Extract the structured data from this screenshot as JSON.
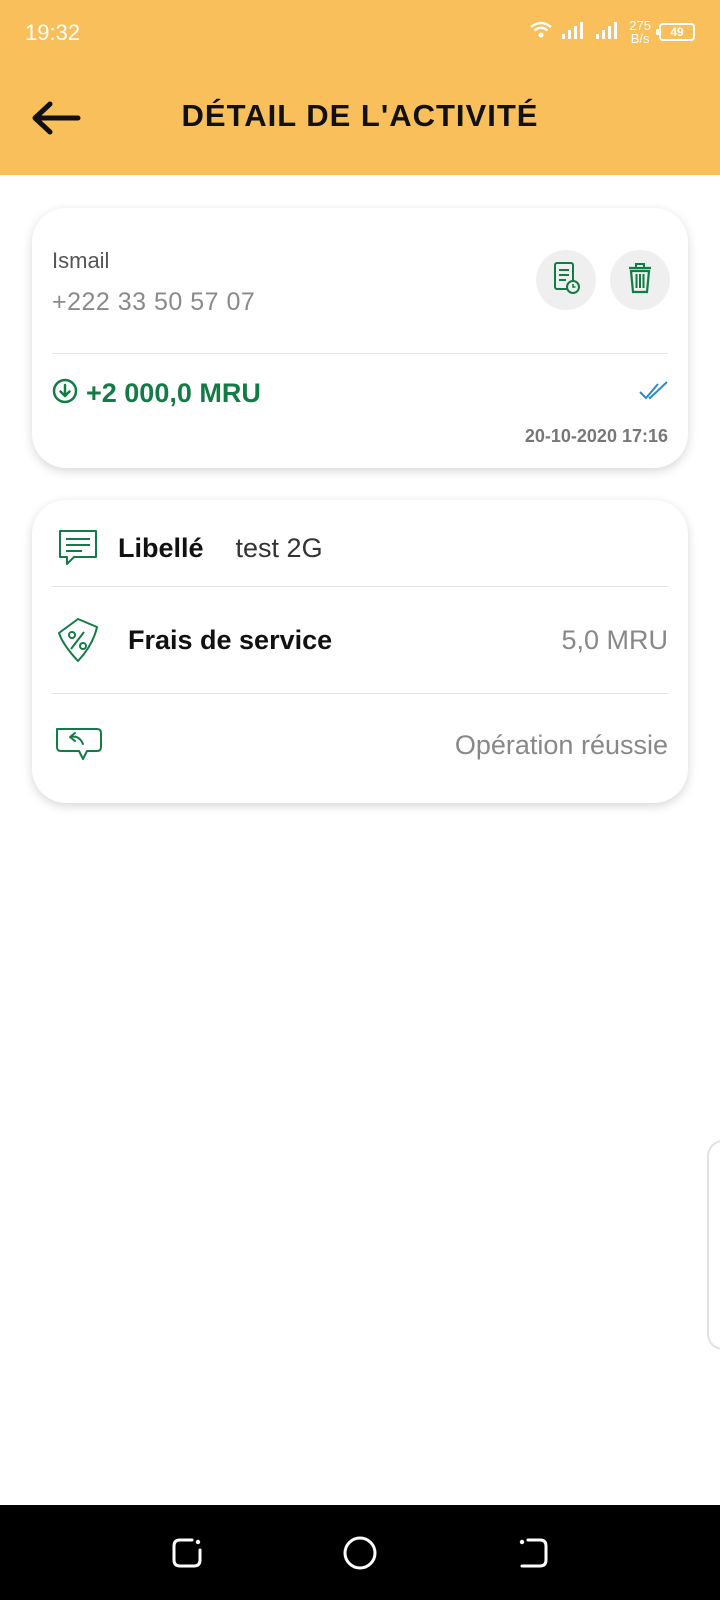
{
  "status_bar": {
    "time": "19:32",
    "net_speed_value": "275",
    "net_speed_unit": "B/s",
    "battery": "49"
  },
  "header": {
    "title": "DÉTAIL DE L'ACTIVITÉ",
    "background_color": "#F8BF5B"
  },
  "transaction": {
    "name": "Ismail",
    "phone": "+222 33 50 57 07",
    "amount": "+2 000,0 MRU",
    "datetime": "20-10-2020 17:16",
    "amount_color": "#137B46",
    "status_check_color": "#2A8CC7"
  },
  "details": {
    "label_title": "Libellé",
    "label_value": "test 2G",
    "fee_title": "Frais de service",
    "fee_value": "5,0 MRU",
    "status_value": "Opération réussie"
  },
  "icons": {
    "back": "arrow-left-icon",
    "receipt": "receipt-icon",
    "delete": "trash-icon",
    "incoming": "arrow-down-circle-icon",
    "check": "double-check-icon",
    "label": "message-icon",
    "fee": "percent-tag-icon",
    "status": "reply-bubble-icon"
  }
}
